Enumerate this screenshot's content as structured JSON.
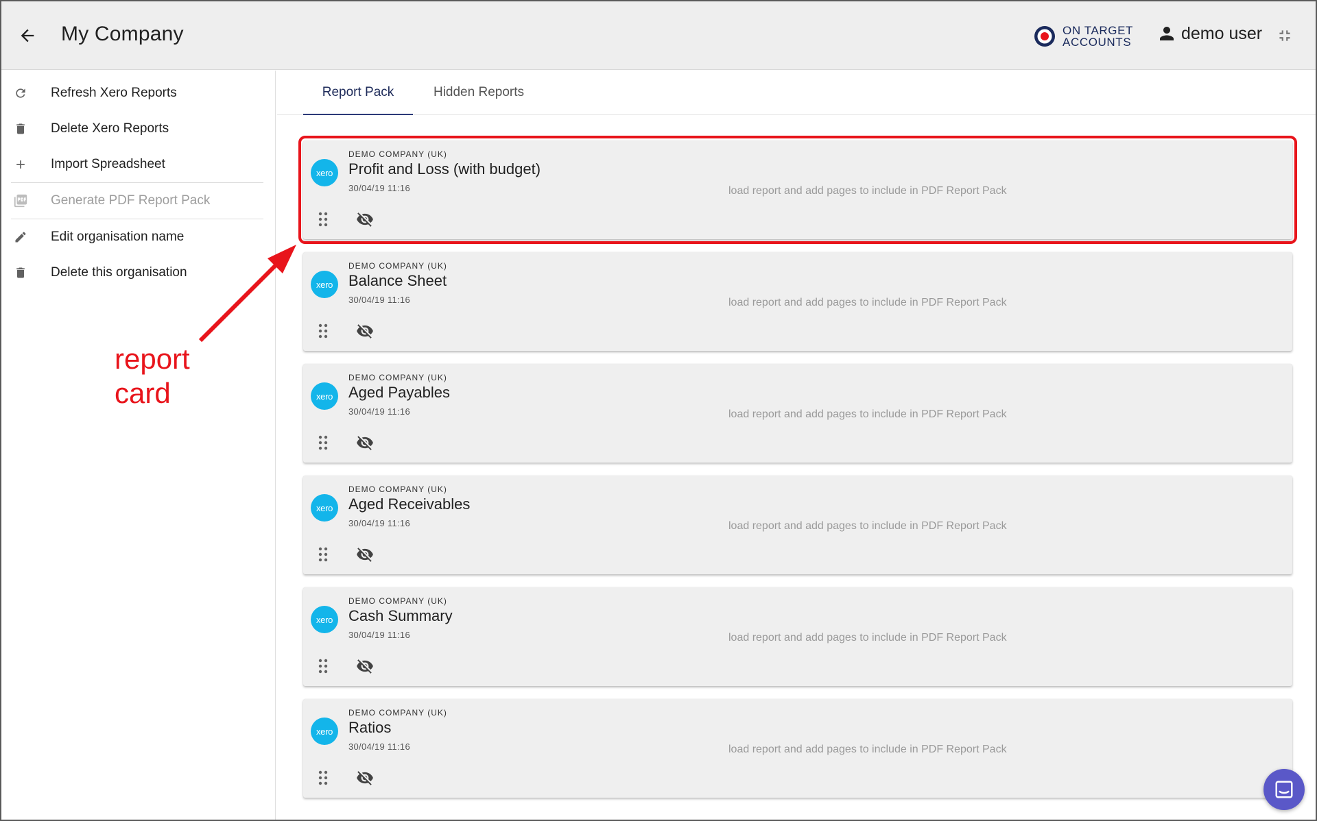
{
  "header": {
    "title": "My Company",
    "brand_line1": "ON TARGET",
    "brand_line2": "ACCOUNTS",
    "user_name": "demo user",
    "icons": {
      "back": "arrow-left-icon",
      "user": "person-icon",
      "collapse": "collapse-icon",
      "brand": "target-logo"
    }
  },
  "sidebar": {
    "items": [
      {
        "label": "Refresh Xero Reports",
        "icon": "refresh-icon",
        "enabled": true
      },
      {
        "label": "Delete Xero Reports",
        "icon": "trash-icon",
        "enabled": true
      },
      {
        "label": "Import Spreadsheet",
        "icon": "plus-icon",
        "enabled": true
      },
      {
        "label": "Generate PDF Report Pack",
        "icon": "pdf-icon",
        "enabled": false
      },
      {
        "label": "Edit organisation name",
        "icon": "pencil-icon",
        "enabled": true
      },
      {
        "label": "Delete this organisation",
        "icon": "trash-icon",
        "enabled": true
      }
    ]
  },
  "annotation": {
    "line1": "report",
    "line2": "card",
    "color": "#e8141b"
  },
  "tabs": [
    {
      "label": "Report Pack",
      "active": true
    },
    {
      "label": "Hidden Reports",
      "active": false
    }
  ],
  "cards": [
    {
      "company": "DEMO COMPANY (UK)",
      "title": "Profit and Loss (with budget)",
      "date": "30/04/19 11:16",
      "hint": "load report and add pages to include in PDF Report Pack",
      "logo": "xero",
      "highlighted": true
    },
    {
      "company": "DEMO COMPANY (UK)",
      "title": "Balance Sheet",
      "date": "30/04/19 11:16",
      "hint": "load report and add pages to include in PDF Report Pack",
      "logo": "xero",
      "highlighted": false
    },
    {
      "company": "DEMO COMPANY (UK)",
      "title": "Aged Payables",
      "date": "30/04/19 11:16",
      "hint": "load report and add pages to include in PDF Report Pack",
      "logo": "xero",
      "highlighted": false
    },
    {
      "company": "DEMO COMPANY (UK)",
      "title": "Aged Receivables",
      "date": "30/04/19 11:16",
      "hint": "load report and add pages to include in PDF Report Pack",
      "logo": "xero",
      "highlighted": false
    },
    {
      "company": "DEMO COMPANY (UK)",
      "title": "Cash Summary",
      "date": "30/04/19 11:16",
      "hint": "load report and add pages to include in PDF Report Pack",
      "logo": "xero",
      "highlighted": false
    },
    {
      "company": "DEMO COMPANY (UK)",
      "title": "Ratios",
      "date": "30/04/19 11:16",
      "hint": "load report and add pages to include in PDF Report Pack",
      "logo": "xero",
      "highlighted": false
    }
  ],
  "colors": {
    "accent": "#2c3a78",
    "xero": "#13b5ea",
    "highlight": "#e8141b",
    "chat": "#5a58c8"
  }
}
